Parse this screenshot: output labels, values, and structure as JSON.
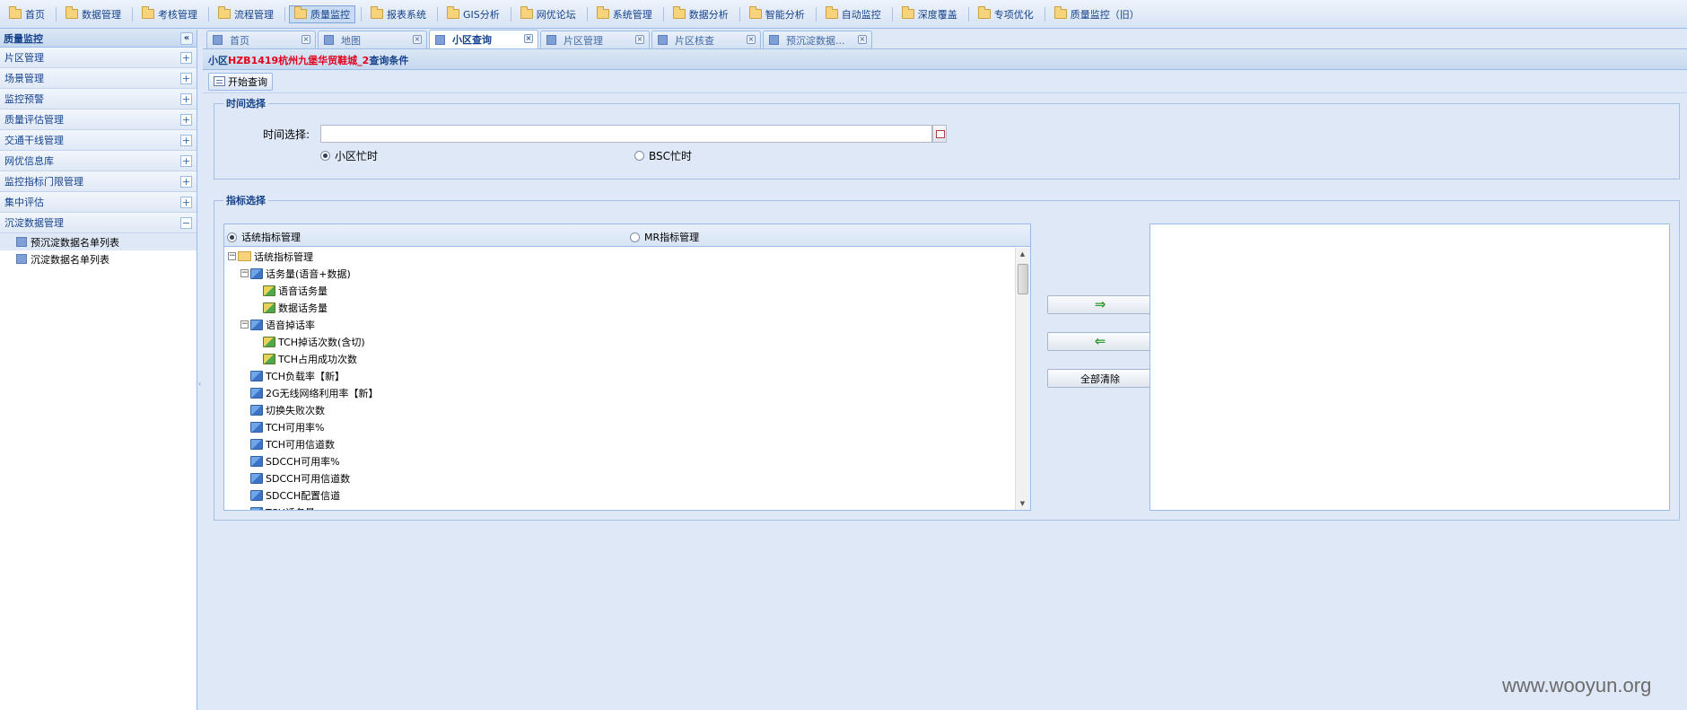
{
  "menu": [
    {
      "label": "首页",
      "active": false
    },
    {
      "label": "数据管理",
      "active": false
    },
    {
      "label": "考核管理",
      "active": false
    },
    {
      "label": "流程管理",
      "active": false
    },
    {
      "label": "质量监控",
      "active": true
    },
    {
      "label": "报表系统",
      "active": false
    },
    {
      "label": "GIS分析",
      "active": false
    },
    {
      "label": "网优论坛",
      "active": false
    },
    {
      "label": "系统管理",
      "active": false
    },
    {
      "label": "数据分析",
      "active": false
    },
    {
      "label": "智能分析",
      "active": false
    },
    {
      "label": "自动监控",
      "active": false
    },
    {
      "label": "深度覆盖",
      "active": false
    },
    {
      "label": "专项优化",
      "active": false
    },
    {
      "label": "质量监控（旧）",
      "active": false
    }
  ],
  "sidebar": {
    "title": "质量监控",
    "collapse_icon": "double-chevron-left",
    "items": [
      {
        "label": "片区管理",
        "toggle": "+"
      },
      {
        "label": "场景管理",
        "toggle": "+"
      },
      {
        "label": "监控预警",
        "toggle": "+"
      },
      {
        "label": "质量评估管理",
        "toggle": "+"
      },
      {
        "label": "交通干线管理",
        "toggle": "+"
      },
      {
        "label": "网优信息库",
        "toggle": "+"
      },
      {
        "label": "监控指标门限管理",
        "toggle": "+"
      },
      {
        "label": "集中评估",
        "toggle": "+"
      },
      {
        "label": "沉淀数据管理",
        "toggle": "−"
      }
    ],
    "sub_items": [
      {
        "label": "预沉淀数据名单列表",
        "selected": true
      },
      {
        "label": "沉淀数据名单列表",
        "selected": false
      }
    ]
  },
  "tabs": [
    {
      "label": "首页",
      "active": false
    },
    {
      "label": "地图",
      "active": false
    },
    {
      "label": "小区查询",
      "active": true
    },
    {
      "label": "片区管理",
      "active": false
    },
    {
      "label": "片区核查",
      "active": false
    },
    {
      "label": "预沉淀数据...",
      "active": false
    }
  ],
  "tab_close_glyph": "×",
  "panel": {
    "title_prefix": "小区",
    "title_cell": "HZB1419杭州九堡华贸鞋城_2",
    "title_suffix": "查询条件",
    "start_query_label": "开始查询"
  },
  "time_section": {
    "legend": "时间选择",
    "label": "时间选择:",
    "value": "",
    "radio_busy_cell": "小区忙时",
    "radio_busy_bsc": "BSC忙时",
    "selected": "小区忙时"
  },
  "index_section": {
    "legend": "指标选择",
    "radio_traffic": "话统指标管理",
    "radio_mr": "MR指标管理",
    "selected": "话统指标管理",
    "tree": [
      {
        "label": "话统指标管理",
        "depth": 0,
        "kind": "folder",
        "toggle": "−"
      },
      {
        "label": "话务量(语音+数据)",
        "depth": 1,
        "kind": "node",
        "toggle": "−"
      },
      {
        "label": "语音话务量",
        "depth": 2,
        "kind": "leaf",
        "toggle": ""
      },
      {
        "label": "数据话务量",
        "depth": 2,
        "kind": "leaf",
        "toggle": ""
      },
      {
        "label": "语音掉话率",
        "depth": 1,
        "kind": "node",
        "toggle": "−"
      },
      {
        "label": "TCH掉话次数(含切)",
        "depth": 2,
        "kind": "leaf",
        "toggle": ""
      },
      {
        "label": "TCH占用成功次数",
        "depth": 2,
        "kind": "leaf",
        "toggle": ""
      },
      {
        "label": "TCH负载率【新】",
        "depth": 1,
        "kind": "node",
        "toggle": ""
      },
      {
        "label": "2G无线网络利用率【新】",
        "depth": 1,
        "kind": "node",
        "toggle": ""
      },
      {
        "label": "切换失败次数",
        "depth": 1,
        "kind": "node",
        "toggle": ""
      },
      {
        "label": "TCH可用率%",
        "depth": 1,
        "kind": "node",
        "toggle": ""
      },
      {
        "label": "TCH可用信道数",
        "depth": 1,
        "kind": "node",
        "toggle": ""
      },
      {
        "label": "SDCCH可用率%",
        "depth": 1,
        "kind": "node",
        "toggle": ""
      },
      {
        "label": "SDCCH可用信道数",
        "depth": 1,
        "kind": "node",
        "toggle": ""
      },
      {
        "label": "SDCCH配置信道",
        "depth": 1,
        "kind": "node",
        "toggle": ""
      },
      {
        "label": "TCH话务量",
        "depth": 1,
        "kind": "node",
        "toggle": ""
      }
    ],
    "add_glyph": "⇒",
    "remove_glyph": "⇐",
    "clear_all_label": "全部清除"
  },
  "scroll_glyphs": {
    "up": "▲",
    "down": "▼"
  },
  "watermark": "www.wooyun.org"
}
